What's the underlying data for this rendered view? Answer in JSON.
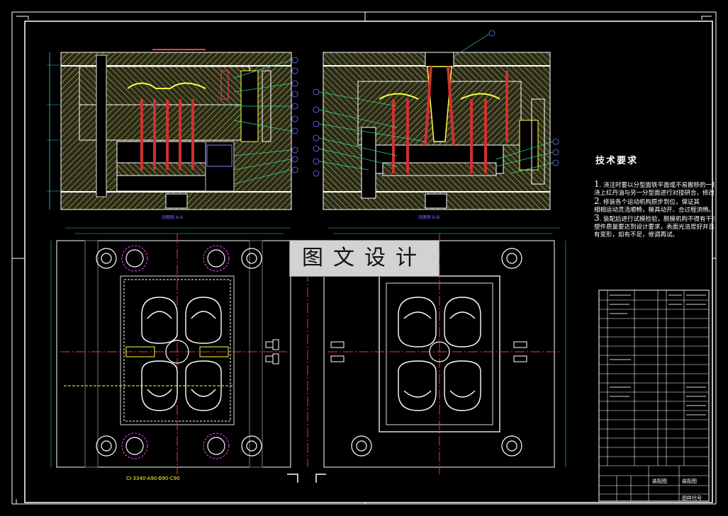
{
  "watermark": "图文设计",
  "technical_requirements": {
    "title": "技术要求",
    "items": [
      {
        "num": "1",
        "lines": [
          "浇注时要以分型面铁平面或不易搬移的一侧作为基准。",
          "浇上红丹油与另一分型面进行对接研合，修改分型面贴合情况。"
        ]
      },
      {
        "num": "2",
        "lines": [
          "修装各个运动机构原步到位，保证其",
          "相相运动灵活顺畅，模具动开、合过程流畅。"
        ]
      },
      {
        "num": "3",
        "lines": [
          "装配后进行试模检验，脱模机构不得有干涉现象，",
          "塑件质量要达到设计要求，表面光洁度好并且不能",
          "有变形，如有不足，修调再试。"
        ]
      }
    ]
  },
  "section_labels": {
    "left": "剖面图 A-A",
    "right": "剖面图 B-B"
  },
  "mold_designation": "CI-3340-A90-B90-C90",
  "title_block": {
    "assembly": "装配图",
    "drawing": "装配图",
    "part_code": "图样代号"
  },
  "colors": {
    "background": "#000000",
    "frame": "#ffffff",
    "hatch": "#c8c866",
    "pin": "#d03030",
    "centerline": "#ff3030",
    "dimension": "#30c8c8",
    "leader": "#30e090",
    "balloon": "#7070ff",
    "part_outline": "#ffffff",
    "yellow": "#ffff40"
  }
}
